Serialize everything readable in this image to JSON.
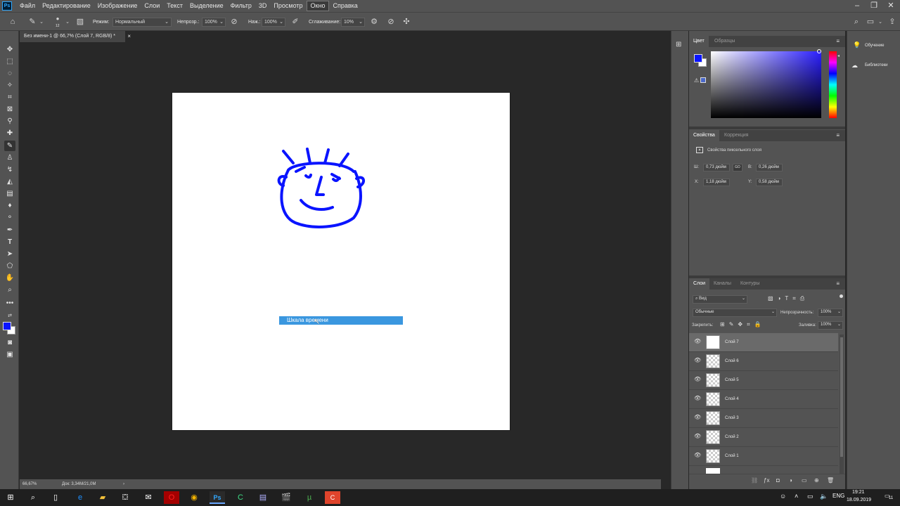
{
  "app": {
    "logo": "Ps"
  },
  "menu": [
    "Файл",
    "Редактирование",
    "Изображение",
    "Слои",
    "Текст",
    "Выделение",
    "Фильтр",
    "3D",
    "Просмотр",
    "Окно",
    "Справка"
  ],
  "options": {
    "brush_size": "12",
    "mode_label": "Режим:",
    "mode_value": "Нормальный",
    "opacity_label": "Непрозр.:",
    "opacity_value": "100%",
    "pressure_label": "Наж.:",
    "pressure_value": "100%",
    "smoothing_label": "Сглаживание:",
    "smoothing_value": "10%"
  },
  "document": {
    "tab_title": "Без имени-1 @ 66,7% (Слой 7, RGB/8) *",
    "close": "×"
  },
  "drag_label": "Шкала времени",
  "status": {
    "zoom": "66,67%",
    "doc": "Док: 3,34M/21,0M",
    "arrow": "›"
  },
  "color_panel": {
    "tabs": [
      "Цвет",
      "Образцы"
    ],
    "fg_color": "#0a14ff",
    "bg_color": "#ffffff"
  },
  "properties": {
    "tabs": [
      "Свойства",
      "Коррекция"
    ],
    "title": "Свойства пиксельного слоя",
    "w_label": "Ш:",
    "w_value": "0,73 дюйм",
    "link": "GO",
    "h_label": "В:",
    "h_value": "0,26 дюйм",
    "x_label": "X:",
    "x_value": "1,18 дюйм",
    "y_label": "Y:",
    "y_value": "0,58 дюйм"
  },
  "layers_panel": {
    "tabs": [
      "Слои",
      "Каналы",
      "Контуры"
    ],
    "filter_value": "Вид",
    "blend_mode": "Обычные",
    "opacity_label": "Непрозрачность:",
    "opacity_value": "100%",
    "lock_label": "Закрепить:",
    "fill_label": "Заливка:",
    "fill_value": "100%",
    "layers": [
      {
        "name": "Слой 7",
        "selected": true
      },
      {
        "name": "Слой 6",
        "selected": false
      },
      {
        "name": "Слой 5",
        "selected": false
      },
      {
        "name": "Слой 4",
        "selected": false
      },
      {
        "name": "Слой 3",
        "selected": false
      },
      {
        "name": "Слой 2",
        "selected": false
      },
      {
        "name": "Слой 1",
        "selected": false
      }
    ]
  },
  "learn_panel": {
    "learn": "Обучение",
    "libraries": "Библиотеки"
  },
  "taskbar": {
    "lang": "ENG",
    "time": "19:21",
    "date": "18.09.2019",
    "notif": "11"
  }
}
